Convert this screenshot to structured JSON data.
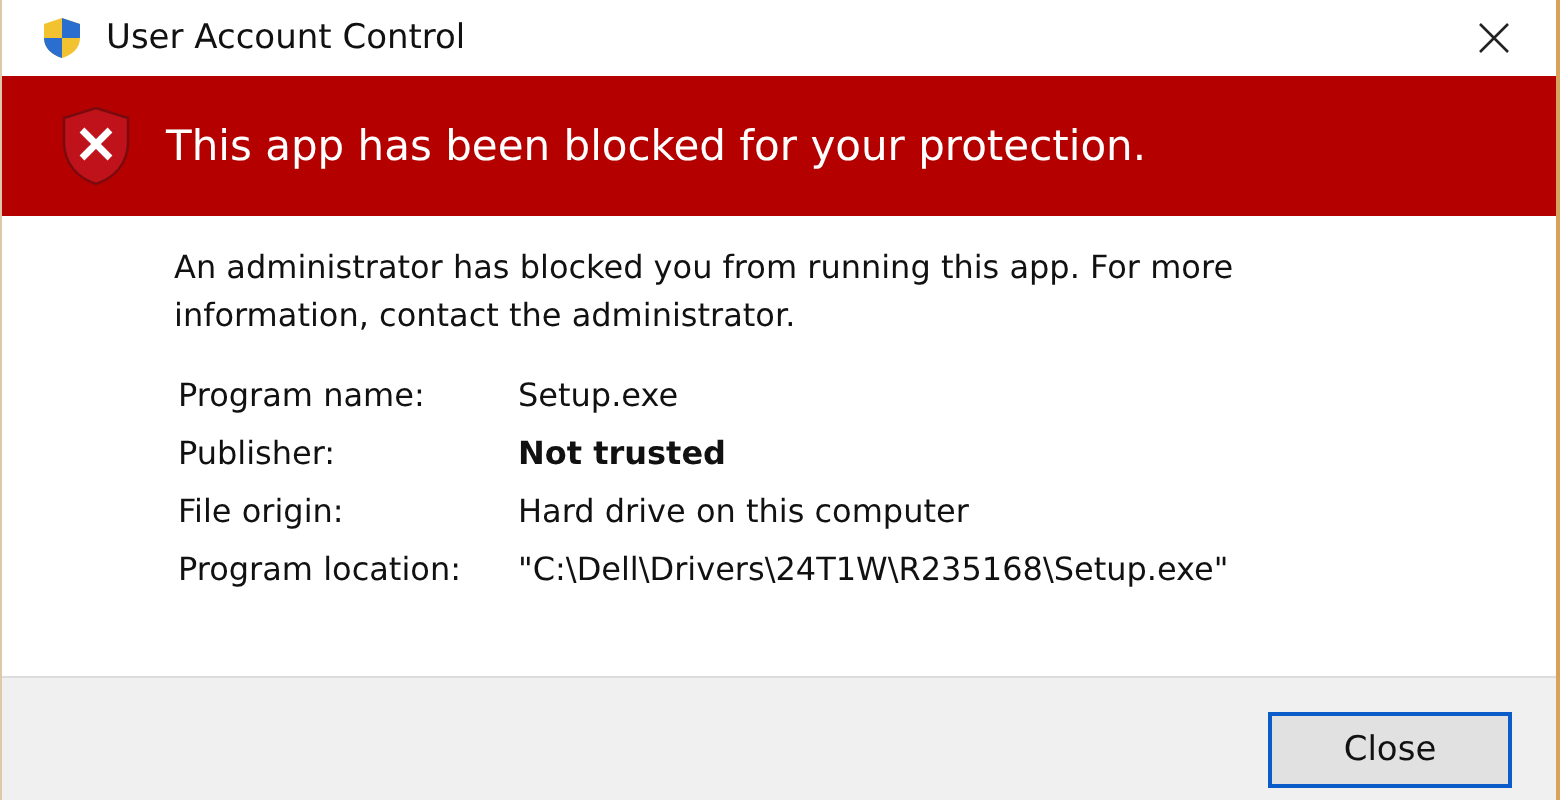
{
  "window": {
    "title": "User Account Control"
  },
  "banner": {
    "message": "This app has been blocked for your protection."
  },
  "body": {
    "text": "An administrator has blocked you from running this app. For more information, contact the administrator."
  },
  "details": [
    {
      "label": "Program name:",
      "value": "Setup.exe",
      "bold": false
    },
    {
      "label": "Publisher:",
      "value": "Not trusted",
      "bold": true
    },
    {
      "label": "File origin:",
      "value": "Hard drive on this computer",
      "bold": false
    },
    {
      "label": "Program location:",
      "value": "\"C:\\Dell\\Drivers\\24T1W\\R235168\\Setup.exe\"",
      "bold": false
    }
  ],
  "buttons": [
    {
      "label": "Close",
      "selected": true
    }
  ]
}
